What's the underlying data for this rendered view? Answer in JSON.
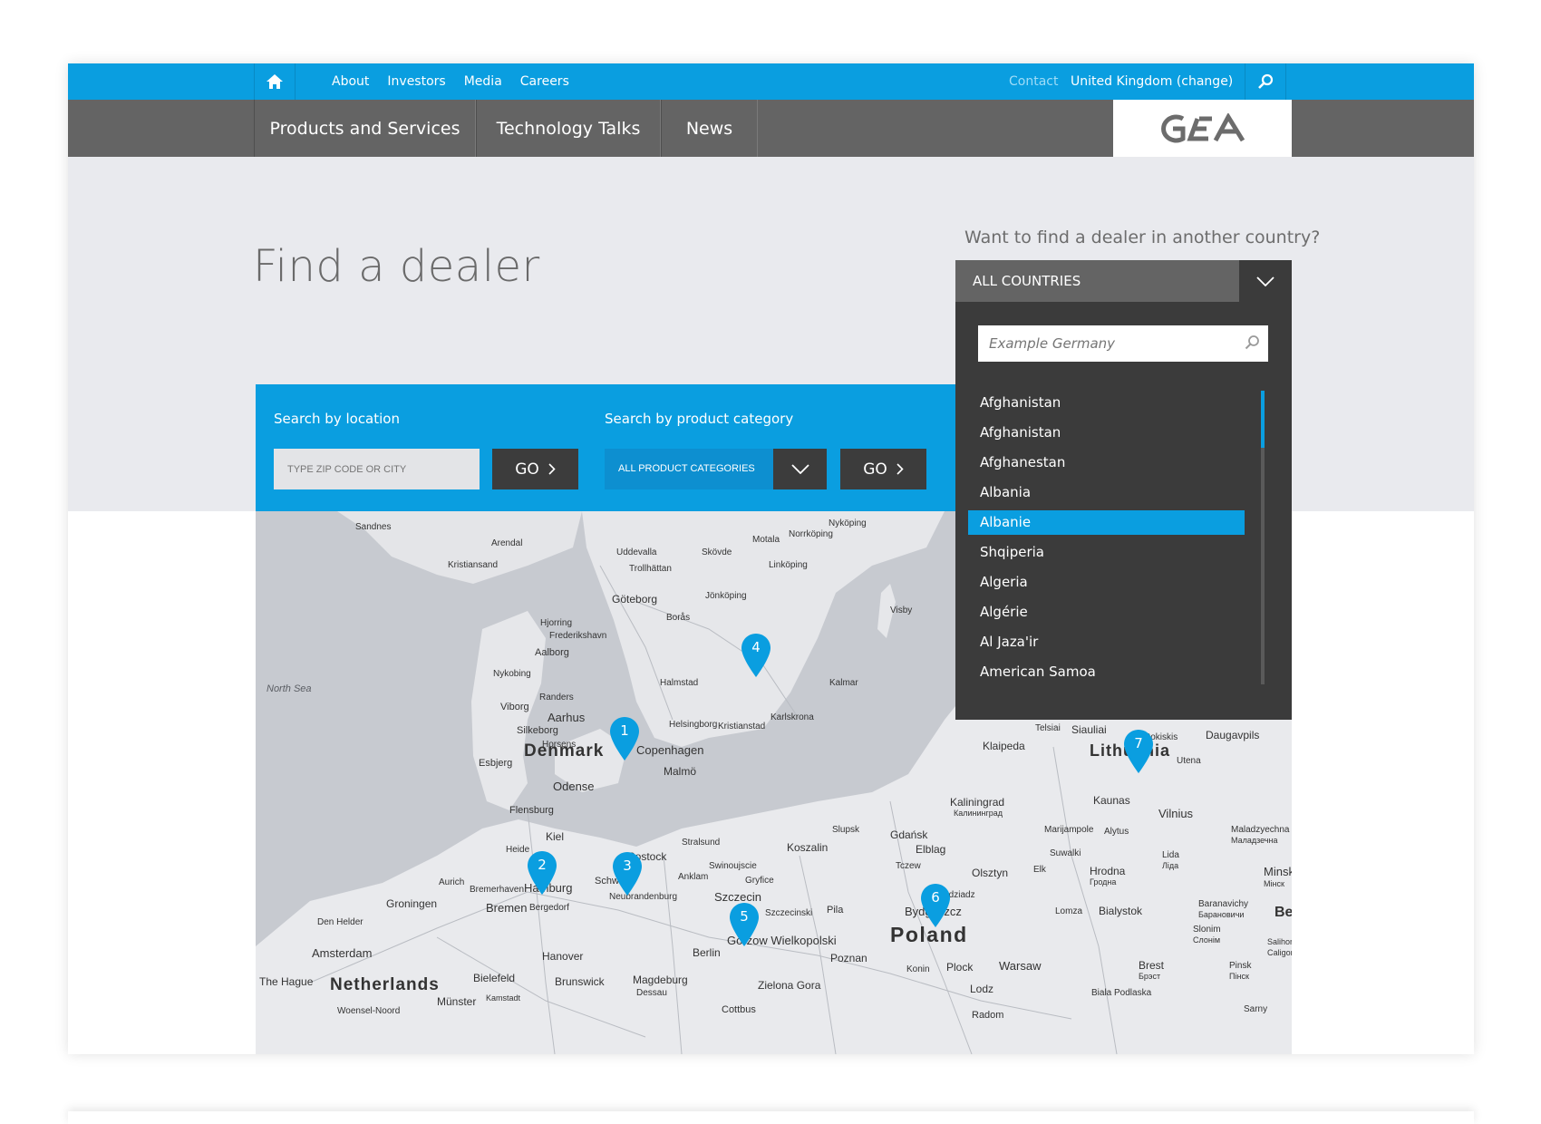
{
  "topbar": {
    "links": [
      "About",
      "Investors",
      "Media",
      "Careers"
    ],
    "contact": "Contact",
    "country": "United Kingdom (change)"
  },
  "mainnav": {
    "items": [
      "Products and Services",
      "Technology Talks",
      "News"
    ],
    "logo_text": "GEA"
  },
  "page": {
    "title": "Find a dealer",
    "other_country_question": "Want to find a dealer in another country?"
  },
  "search": {
    "location_label": "Search by location",
    "zip_placeholder": "TYPE ZIP CODE OR CITY",
    "go_label": "GO",
    "category_label": "Search by product category",
    "category_value": "ALL PRODUCT CATEGORIES"
  },
  "country_dropdown": {
    "selected": "ALL COUNTRIES",
    "search_placeholder": "Example Germany",
    "items": [
      "Afghanistan",
      "Afghanistan",
      "Afghanestan",
      "Albania",
      "Albanie",
      "Shqiperia",
      "Algeria",
      "Algérie",
      "Al Jaza'ir",
      "American Samoa"
    ],
    "active_item": "Albanie"
  },
  "map": {
    "pins": [
      "1",
      "2",
      "3",
      "4",
      "5",
      "6",
      "7"
    ],
    "countries": [
      "Denmark",
      "Poland",
      "Lithuania",
      "Netherlands"
    ],
    "sea": "North Sea",
    "cities": [
      "Sandnes",
      "Arendal",
      "Kristiansand",
      "Uddevalla",
      "Trollhättan",
      "Göteborg",
      "Borås",
      "Jönköping",
      "Skövde",
      "Motala",
      "Norrköping",
      "Linköping",
      "Nyköping",
      "Visby",
      "Hjorring",
      "Frederikshavn",
      "Aalborg",
      "Nykobing",
      "Viborg",
      "Randers",
      "Aarhus",
      "Silkeborg",
      "Horsens",
      "Esbjerg",
      "Odense",
      "Halmstad",
      "Helsingborg",
      "Kristianstad",
      "Karlskrona",
      "Kalmar",
      "Copenhagen",
      "Malmö",
      "Flensburg",
      "Kiel",
      "Heide",
      "Stralsund",
      "Rostock",
      "Bremerhaven",
      "Hamburg",
      "Bergedorf",
      "Schwerin",
      "Neubrandenburg",
      "Anklam",
      "Swinoujscie",
      "Gryfice",
      "Szczecin",
      "Koszalin",
      "Slupsk",
      "Gdańsk",
      "Elblag",
      "Tczew",
      "Kaliningrad",
      "Калининград",
      "Klaipeda",
      "Telsiai",
      "Siauliai",
      "Rokiskis",
      "Daugavpils",
      "Utena",
      "Kaunas",
      "Vilnius",
      "Marijampole",
      "Alytus",
      "Suwalki",
      "Olsztyn",
      "Elk",
      "Hrodna",
      "Гродна",
      "Lida",
      "Ліда",
      "Maladzyechna",
      "Маладзечна",
      "Bydgoszcz",
      "Grudziadz",
      "Pila",
      "Szczecinski",
      "Gorzow Wielkopolski",
      "Berlin",
      "Poznan",
      "Konin",
      "Plock",
      "Warsaw",
      "Lomza",
      "Bialystok",
      "Baranavichy",
      "Барановичи",
      "Slonim",
      "Слонім",
      "Brest",
      "Брэст",
      "Pinsk",
      "Пінск",
      "Lodz",
      "Radom",
      "Biala Podlaska",
      "Sarny",
      "Salihor",
      "Саligor",
      "Zielona Gora",
      "Cottbus",
      "Magdeburg",
      "Dessau",
      "Brunswick",
      "Hanover",
      "Bielefeld",
      "Münster",
      "Kamstadt",
      "Bremen",
      "Aurich",
      "Groningen",
      "Den Helder",
      "Amsterdam",
      "The Hague",
      "Woensel-Noord",
      "Minsk",
      "Мінск",
      "Be"
    ]
  }
}
